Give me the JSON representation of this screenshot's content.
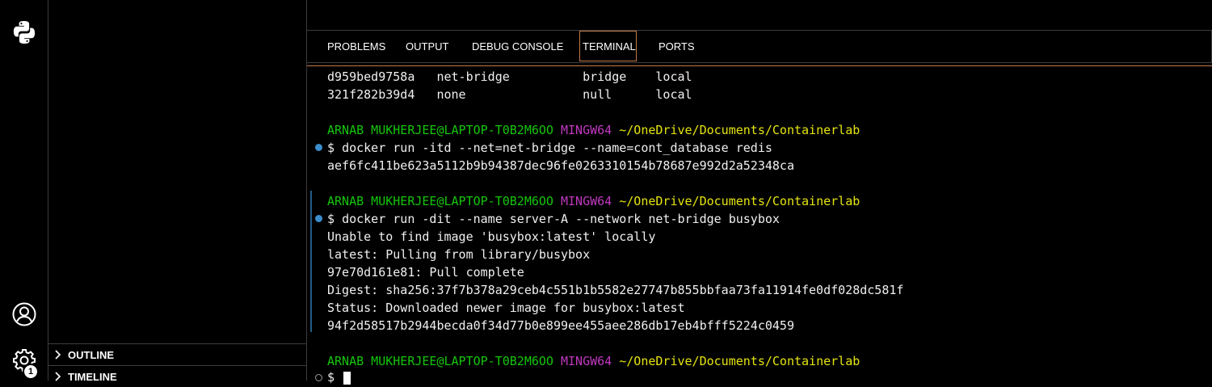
{
  "activity_bar": {
    "icons": [
      "python-icon",
      "account-icon",
      "settings-gear-icon"
    ],
    "settings_badge": "1"
  },
  "sidebar": {
    "sections": [
      {
        "label": "OUTLINE",
        "icon": "chevron-right-icon"
      },
      {
        "label": "TIMELINE",
        "icon": "chevron-right-icon"
      }
    ]
  },
  "panel": {
    "tabs": [
      {
        "label": "PROBLEMS",
        "active": false
      },
      {
        "label": "OUTPUT",
        "active": false
      },
      {
        "label": "DEBUG CONSOLE",
        "active": false
      },
      {
        "label": "TERMINAL",
        "active": true
      },
      {
        "label": "PORTS",
        "active": false
      }
    ]
  },
  "terminal": {
    "network_rows": [
      {
        "id": "d959bed9758a",
        "name": "net-bridge",
        "driver": "bridge",
        "scope": "local"
      },
      {
        "id": "321f282b39d4",
        "name": "none",
        "driver": "null",
        "scope": "local"
      }
    ],
    "prompt": {
      "user_host": "ARNAB MUKHERJEE@LAPTOP-T0B2M6OO",
      "shell": "MINGW64",
      "path": "~/OneDrive/Documents/Containerlab",
      "symbol": "$"
    },
    "cmd1": "docker run -itd --net=net-bridge --name=cont_database redis",
    "cmd1_output": "aef6fc411be623a5112b9b94387dec96fe0263310154b78687e992d2a52348ca",
    "cmd2": "docker run -dit --name server-A --network net-bridge busybox",
    "cmd2_output": [
      "Unable to find image 'busybox:latest' locally",
      "latest: Pulling from library/busybox",
      "97e70d161e81: Pull complete",
      "Digest: sha256:37f7b378a29ceb4c551b1b5582e27747b855bbfaa73fa11914fe0df028dc581f",
      "Status: Downloaded newer image for busybox:latest",
      "94f2d58517b2944becda0f34d77b0e899ee455aee286db17eb4bfff5224c0459"
    ]
  },
  "colors": {
    "accent_tab_border": "#c27b4a",
    "prompt_user": "#16c60c",
    "prompt_shell": "#c039c0",
    "prompt_path": "#e5e510",
    "decoration_success": "#3a8ecd"
  }
}
